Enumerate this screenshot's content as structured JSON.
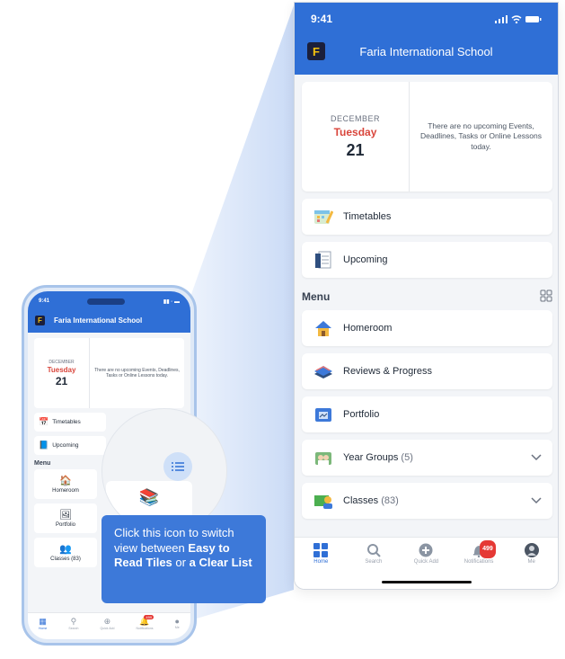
{
  "status_time": "9:41",
  "school_name": "Faria International School",
  "logo_letter": "F",
  "date_card": {
    "month": "DECEMBER",
    "weekday": "Tuesday",
    "day": "21",
    "message": "There are no upcoming Events, Deadlines, Tasks or Online Lessons today."
  },
  "quick_rows": [
    {
      "label": "Timetables",
      "icon": "timetable-icon"
    },
    {
      "label": "Upcoming",
      "icon": "upcoming-icon"
    }
  ],
  "menu": {
    "title": "Menu",
    "toggle_icon": "grid-view-icon",
    "items": [
      {
        "label": "Homeroom",
        "icon": "homeroom-icon"
      },
      {
        "label": "Reviews & Progress",
        "icon": "reviews-icon"
      },
      {
        "label": "Portfolio",
        "icon": "portfolio-icon"
      },
      {
        "label": "Year Groups",
        "count": "(5)",
        "icon": "year-groups-icon"
      },
      {
        "label": "Classes",
        "count": "(83)",
        "icon": "classes-icon"
      }
    ]
  },
  "tabs": [
    {
      "label": "Home",
      "icon": "home-icon",
      "active": true
    },
    {
      "label": "Search",
      "icon": "search-icon"
    },
    {
      "label": "Quick Add",
      "icon": "quick-add-icon"
    },
    {
      "label": "Notifications",
      "icon": "bell-icon",
      "badge": "499"
    },
    {
      "label": "Me",
      "icon": "avatar-icon"
    }
  ],
  "small_phone": {
    "tiles": [
      "Homeroom",
      "Portfolio",
      "Classes (83)"
    ],
    "badge": "499"
  },
  "callout": {
    "line1": "Click this icon to switch view between",
    "strong1": "Easy to Read Tiles",
    "mid": "or",
    "strong2": "a Clear List"
  },
  "colors": {
    "accent": "#2f6fd6",
    "date_red": "#d9463c",
    "badge_red": "#e53935"
  }
}
